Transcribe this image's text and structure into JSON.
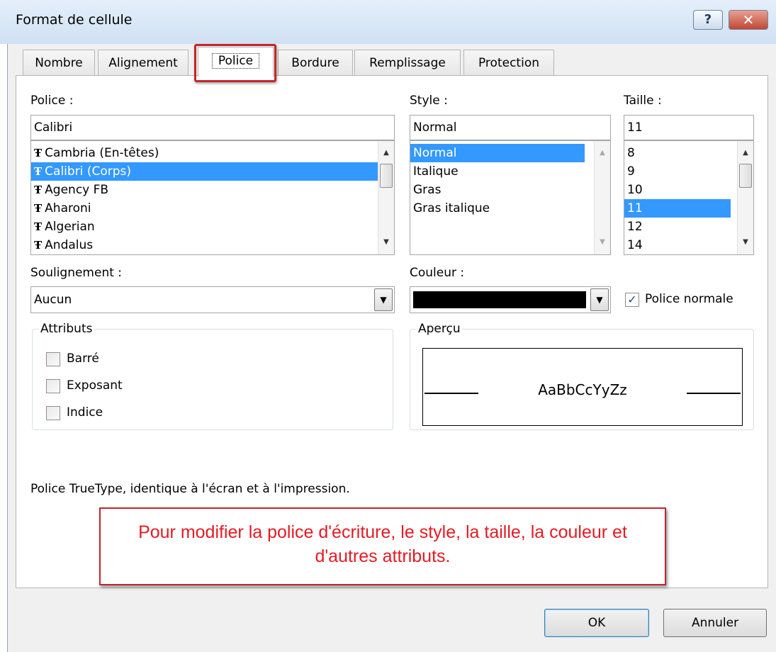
{
  "window": {
    "title": "Format de cellule",
    "help_glyph": "?",
    "close_glyph": "✕"
  },
  "tabs": [
    {
      "label": "Nombre"
    },
    {
      "label": "Alignement"
    },
    {
      "label": "Police"
    },
    {
      "label": "Bordure"
    },
    {
      "label": "Remplissage"
    },
    {
      "label": "Protection"
    }
  ],
  "font": {
    "label": "Police :",
    "value": "Calibri",
    "icon_glyph": "Ŧ",
    "items": [
      "Cambria (En-têtes)",
      "Calibri (Corps)",
      "Agency FB",
      "Aharoni",
      "Algerian",
      "Andalus"
    ],
    "selected_index": 1
  },
  "style": {
    "label": "Style :",
    "value": "Normal",
    "items": [
      "Normal",
      "Italique",
      "Gras",
      "Gras italique"
    ],
    "selected_index": 0
  },
  "size": {
    "label": "Taille :",
    "value": "11",
    "items": [
      "8",
      "9",
      "10",
      "11",
      "12",
      "14"
    ],
    "selected_index": 3
  },
  "underline": {
    "label": "Soulignement :",
    "value": "Aucun"
  },
  "color": {
    "label": "Couleur :",
    "swatch": "#000000",
    "normal_font_label": "Police normale",
    "normal_font_checked": true
  },
  "attributes": {
    "title": "Attributs",
    "items": [
      {
        "label": "Barré",
        "checked": false
      },
      {
        "label": "Exposant",
        "checked": false
      },
      {
        "label": "Indice",
        "checked": false
      }
    ]
  },
  "preview": {
    "title": "Aperçu",
    "sample": "AaBbCcYyZz"
  },
  "info": "Police TrueType, identique à l'écran et à l'impression.",
  "callout": "Pour modifier la police d'écriture, le style, la taille, la couleur et d'autres attributs.",
  "buttons": {
    "ok": "OK",
    "cancel": "Annuler"
  },
  "colors": {
    "selection": "#3399ff",
    "highlight": "#c3262b",
    "callout_text": "#e31b23"
  }
}
